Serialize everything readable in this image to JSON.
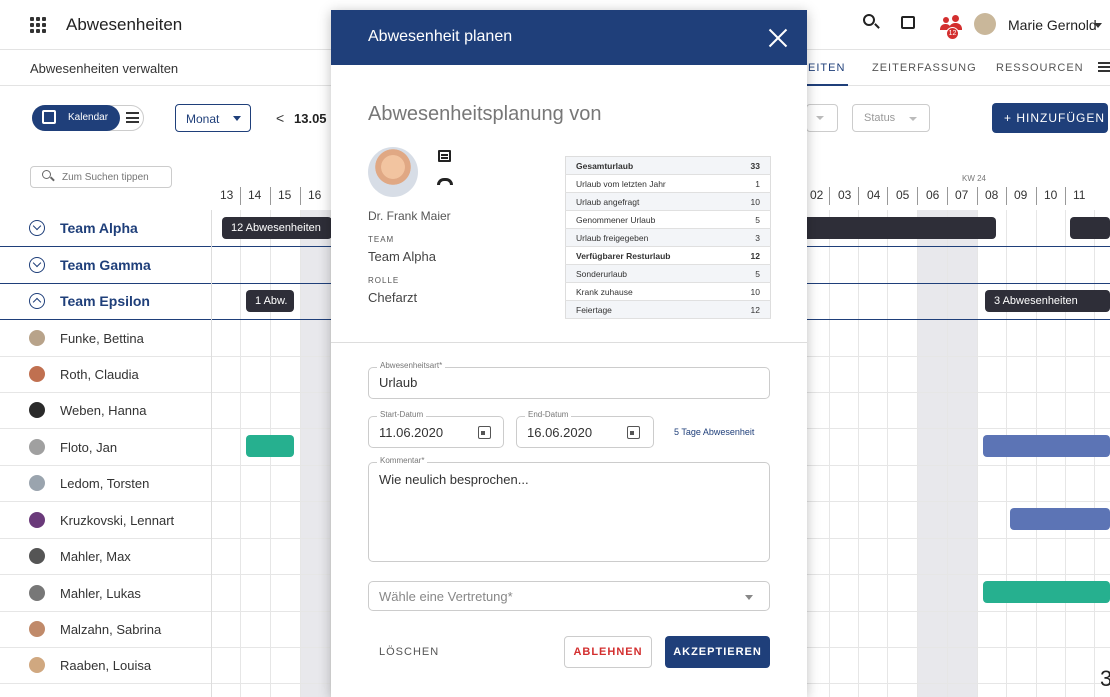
{
  "app": {
    "title": "Abwesenheiten",
    "subtitle": "Abwesenheiten verwalten"
  },
  "header": {
    "user_name": "Marie Gernold",
    "notification_count": "12",
    "icons": [
      "search-icon",
      "feedback-icon",
      "team-icon",
      "user-avatar"
    ]
  },
  "nav_tabs": [
    {
      "label": "EITEN",
      "active": true
    },
    {
      "label": "ZEITERFASSUNG"
    },
    {
      "label": "RESSOURCEN"
    }
  ],
  "toolbar": {
    "calendar_label": "Kalendar",
    "period_select": "Monat",
    "prev_symbol": "<",
    "date_label": "13.05",
    "status_filter": "Status",
    "add_button": "+ HINZUFÜGEN"
  },
  "search": {
    "placeholder": "Zum Suchen tippen"
  },
  "calendar": {
    "week_label": "KW 24",
    "left_days": [
      "13",
      "14",
      "15",
      "16"
    ],
    "right_days": [
      "02",
      "03",
      "04",
      "05",
      "06",
      "07",
      "08",
      "09",
      "10",
      "11"
    ],
    "teams": [
      {
        "name": "Team Alpha",
        "expanded": false
      },
      {
        "name": "Team Gamma",
        "expanded": false
      },
      {
        "name": "Team Epsilon",
        "expanded": true
      }
    ],
    "members": [
      "Funke, Bettina",
      "Roth, Claudia",
      "Weben, Hanna",
      "Floto, Jan",
      "Ledom, Torsten",
      "Kruzkovski, Lennart",
      "Mahler, Max",
      "Mahler, Lukas",
      "Malzahn, Sabrina",
      "Raaben, Louisa"
    ],
    "bars": {
      "alpha_left": "12 Abwesenheiten",
      "epsilon_left": "1 Abw.",
      "epsilon_right": "3 Abwesenheiten"
    },
    "colors": {
      "team_bar": "#2e2e38",
      "green": "#26b08f",
      "blue": "#5c74b5",
      "primary": "#1f3f7a"
    }
  },
  "dialog": {
    "title": "Abwesenheit planen",
    "heading": "Abwesenheitsplanung von",
    "person": {
      "name": "Dr. Frank Maier",
      "team_label": "TEAM",
      "team": "Team Alpha",
      "role_label": "ROLLE",
      "role": "Chefarzt"
    },
    "stats": [
      {
        "label": "Gesamturlaub",
        "value": "33",
        "bold": true
      },
      {
        "label": "Urlaub vom letzten Jahr",
        "value": "1"
      },
      {
        "label": "Urlaub angefragt",
        "value": "10"
      },
      {
        "label": "Genommener Urlaub",
        "value": "5"
      },
      {
        "label": "Urlaub freigegeben",
        "value": "3"
      },
      {
        "label": "Verfügbarer Resturlaub",
        "value": "12",
        "bold": true
      },
      {
        "label": "Sonderurlaub",
        "value": "5"
      },
      {
        "label": "Krank zuhause",
        "value": "10"
      },
      {
        "label": "Feiertage",
        "value": "12"
      }
    ],
    "form": {
      "type_label": "Abwesenheitsart*",
      "type_value": "Urlaub",
      "start_label": "Start-Datum",
      "start_value": "11.06.2020",
      "end_label": "End-Datum",
      "end_value": "16.06.2020",
      "days_info": "5  Tage Abwesenheit",
      "comment_label": "Kommentar*",
      "comment_value": "Wie neulich besprochen...",
      "substitute_placeholder": "Wähle eine Vertretung*"
    },
    "buttons": {
      "delete": "LÖSCHEN",
      "reject": "ABLEHNEN",
      "accept": "AKZEPTIEREN"
    }
  },
  "misc": {
    "corner_text": "3"
  }
}
